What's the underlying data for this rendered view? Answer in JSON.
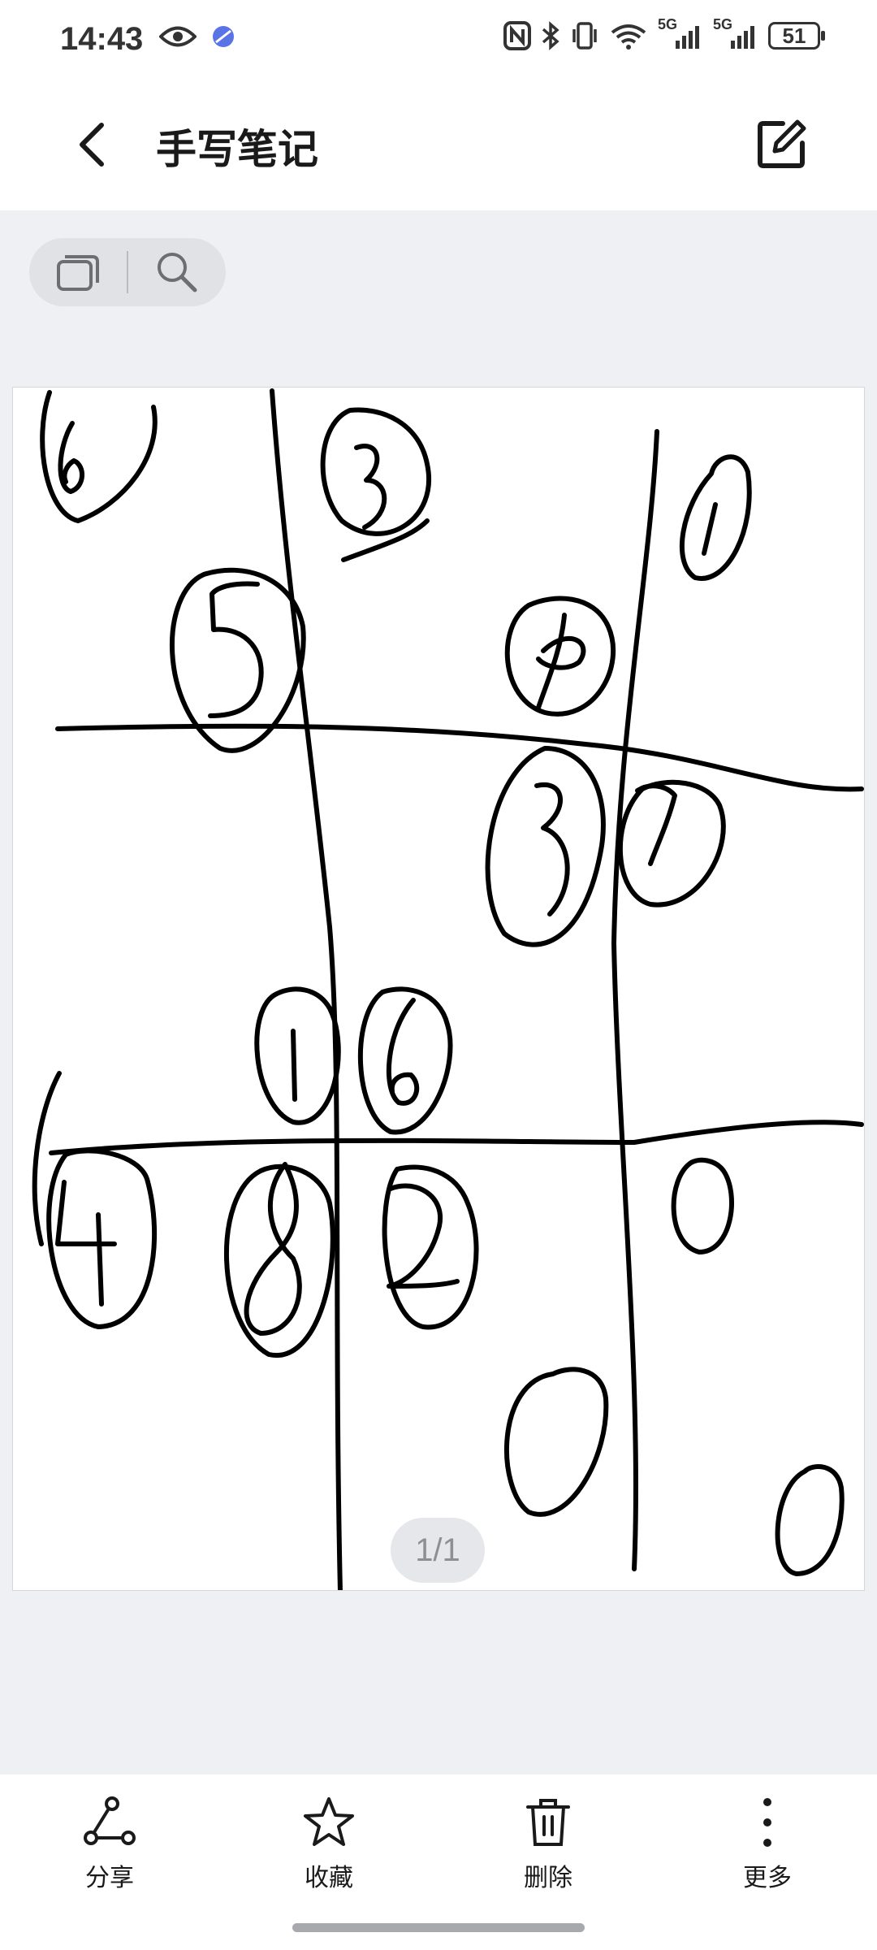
{
  "status_bar": {
    "time": "14:43",
    "battery": "51",
    "icons": [
      "eye-icon",
      "app-dot-icon",
      "nfc-icon",
      "bluetooth-icon",
      "vibrate-icon",
      "wifi-icon",
      "signal-5g-icon",
      "signal-5g-icon"
    ],
    "network_label": "5G"
  },
  "header": {
    "title": "手写笔记",
    "back_icon": "chevron-left-icon",
    "edit_icon": "edit-icon"
  },
  "toolbar": {
    "icons": [
      "pages-icon",
      "search-icon"
    ]
  },
  "canvas": {
    "content": "handwritten grid with circled digits",
    "page_indicator": "1/1"
  },
  "bottom_bar": {
    "items": [
      {
        "label": "分享",
        "icon": "share-icon"
      },
      {
        "label": "收藏",
        "icon": "star-icon"
      },
      {
        "label": "删除",
        "icon": "trash-icon"
      },
      {
        "label": "更多",
        "icon": "more-icon"
      }
    ]
  },
  "colors": {
    "background": "#eff0f4",
    "ink": "#000000"
  }
}
